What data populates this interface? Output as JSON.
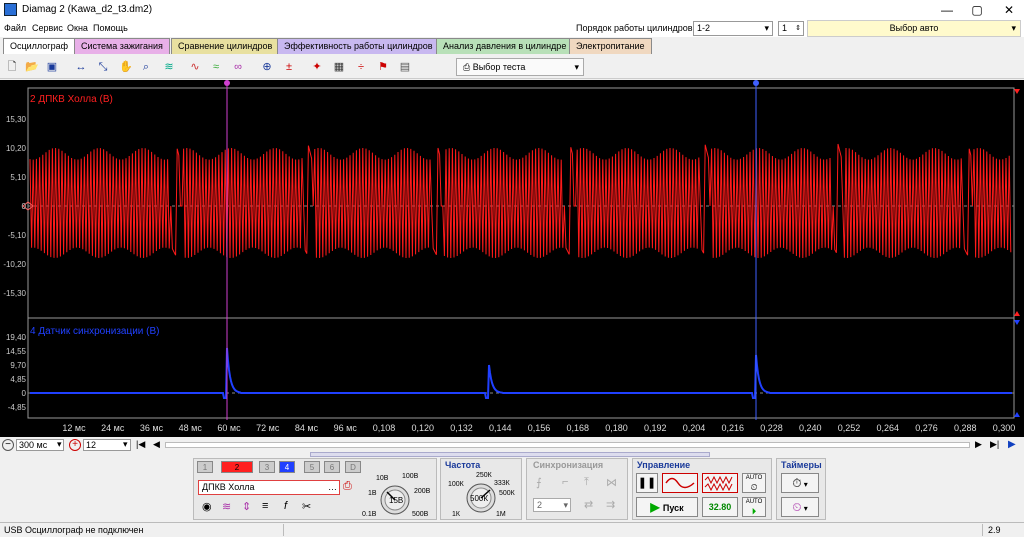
{
  "window": {
    "title": "Diamag 2 (Kawa_d2_t3.dm2)",
    "controls": [
      "—",
      "▢",
      "✕"
    ]
  },
  "menu": [
    "Файл",
    "Сервис",
    "Окна",
    "Помощь"
  ],
  "header_right": {
    "cyl_order_label": "Порядок работы цилиндров",
    "cyl_order_value": "1-2",
    "cyl_num_value": "1",
    "auto_select_label": "Выбор авто"
  },
  "tabs": [
    {
      "label": "Осциллограф",
      "color": "#ffffff"
    },
    {
      "label": "Система зажигания",
      "color": "#e8b0e8"
    },
    {
      "label": "Сравнение цилиндров",
      "color": "#e8e0a0"
    },
    {
      "label": "Эффективность работы цилиндров",
      "color": "#c8b8f0"
    },
    {
      "label": "Анализ давления в цилиндре",
      "color": "#b8e0b8"
    },
    {
      "label": "Электропитание",
      "color": "#f0d8c0"
    }
  ],
  "toolbar": {
    "test_select_label": "Выбор теста",
    "icons": [
      "new-icon",
      "open-icon",
      "save-icon",
      "measure-icon",
      "scale-icon",
      "hand-icon",
      "zoom-icon",
      "filter-icon",
      "wave1-icon",
      "wave2-icon",
      "wave3-icon",
      "auto-icon",
      "zero-icon",
      "cursor-icon",
      "grid-icon",
      "split-icon",
      "marker-icon",
      "page-icon"
    ]
  },
  "channel1": {
    "label": "2 ДПКВ Холла (В)",
    "color": "#ff2020",
    "y_ticks": [
      "15,30",
      "10,20",
      "5,10",
      "0",
      "-5,10",
      "-10,20",
      "-15,30"
    ]
  },
  "channel2": {
    "label": "4 Датчик синхронизации (В)",
    "color": "#2040ff",
    "y_ticks": [
      "19,40",
      "14,55",
      "9,70",
      "4,85",
      "0",
      "-4,85"
    ]
  },
  "x_ticks": [
    "12 мс",
    "24 мс",
    "36 мс",
    "48 мс",
    "60 мс",
    "72 мс",
    "84 мс",
    "96 мс",
    "0,108",
    "0,120",
    "0,132",
    "0,144",
    "0,156",
    "0,168",
    "0,180",
    "0,192",
    "0,204",
    "0,216",
    "0,228",
    "0,240",
    "0,252",
    "0,264",
    "0,276",
    "0,288",
    "0,300"
  ],
  "cursors": [
    "1",
    "2"
  ],
  "bottom": {
    "timebase": "300 мс",
    "points": "12"
  },
  "panel": {
    "channels": [
      "1",
      "2",
      "3",
      "4",
      "5",
      "6",
      "D"
    ],
    "channel_name": "ДПКВ Холла",
    "volt_knob": {
      "value": "15В",
      "labels": [
        "10В",
        "100В",
        "1В",
        "200В",
        "0.1В",
        "500В"
      ]
    },
    "freq_title": "Частота",
    "freq_knob": {
      "value": "500К",
      "labels": [
        "250К",
        "100К",
        "333К",
        "500К",
        "1К",
        "1М"
      ]
    },
    "sync_title": "Синхронизация",
    "sync_value": "2",
    "control_title": "Управление",
    "start_label": "Пуск",
    "rate_value": "32.80",
    "auto_label": "AUTO",
    "timers_title": "Таймеры"
  },
  "status": {
    "left": "USB Осциллограф не подключен",
    "right": "2.9"
  }
}
